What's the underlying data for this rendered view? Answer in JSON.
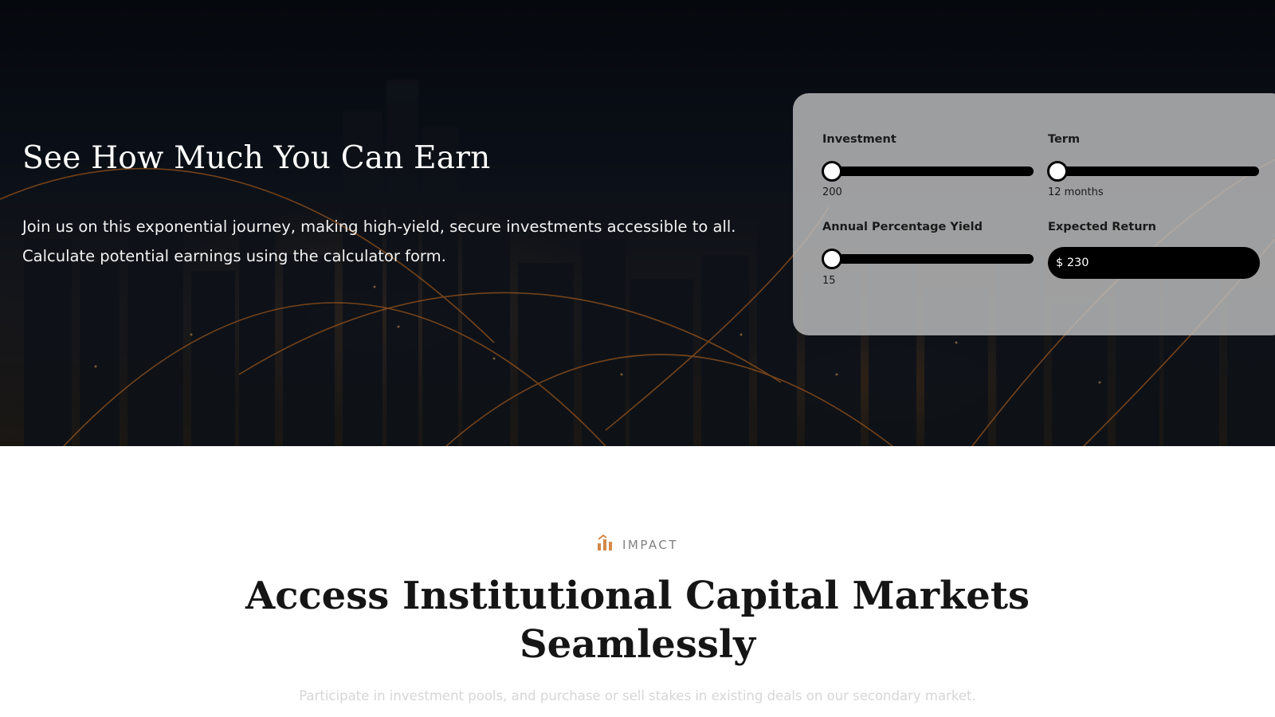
{
  "hero": {
    "title": "See How Much You Can Earn",
    "description_line1": "Join us on this exponential journey, making high-yield, secure investments accessible to all.",
    "description_line2": "Calculate potential earnings using the calculator form."
  },
  "calculator": {
    "investment": {
      "label": "Investment",
      "value": "200",
      "slider_fraction": 0.0
    },
    "term": {
      "label": "Term",
      "value": "12 months",
      "slider_fraction": 0.0
    },
    "apy": {
      "label": "Annual Percentage Yield",
      "value": "15",
      "slider_fraction": 0.0
    },
    "expected_return": {
      "label": "Expected Return",
      "value": "$ 230"
    }
  },
  "impact": {
    "eyebrow": "IMPACT",
    "icon": "bar-chart-growth-icon",
    "title_line1": "Access Institutional Capital Markets",
    "title_line2": "Seamlessly",
    "subtitle": "Participate in investment pools, and purchase or sell stakes in existing deals on our secondary market."
  },
  "colors": {
    "accent": "#d4894a",
    "panel": "#bdbdbd",
    "slider_track": "#000000"
  }
}
